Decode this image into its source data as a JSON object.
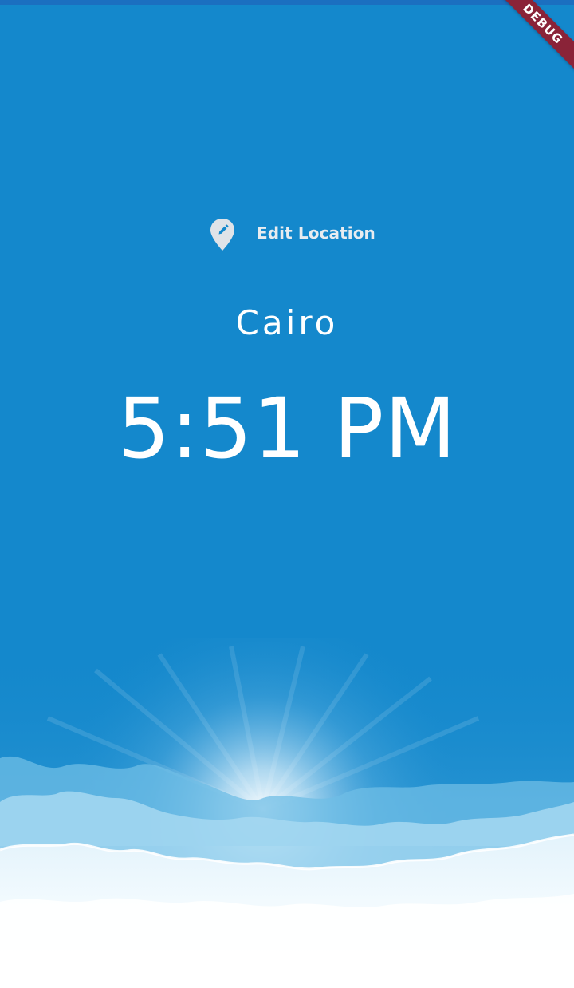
{
  "debug_banner": "DEBUG",
  "edit_location": {
    "label": "Edit Location",
    "icon": "edit-location-icon"
  },
  "location": {
    "city": "Cairo",
    "time": "5:51 PM"
  },
  "colors": {
    "background": "#1488cc",
    "text": "#ffffff",
    "banner": "#8a2338"
  },
  "background_illustration": "daytime-clouds-sun"
}
